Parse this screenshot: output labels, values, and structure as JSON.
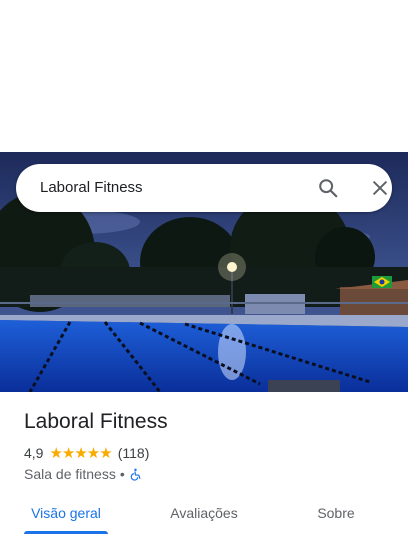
{
  "search": {
    "query": "Laboral Fitness"
  },
  "place": {
    "name": "Laboral Fitness",
    "rating": "4,9",
    "stars": "★★★★★",
    "review_count": "(118)",
    "category": "Sala de fitness",
    "separator": "•"
  },
  "tabs": [
    {
      "label": "Visão geral"
    },
    {
      "label": "Avaliações"
    },
    {
      "label": "Sobre"
    }
  ],
  "icons": {
    "search": "search-icon",
    "close": "close-icon",
    "accessibility": "wheelchair-icon"
  },
  "colors": {
    "accent": "#1a73e8",
    "star": "#f9ab00",
    "pool": "#0a3ea8"
  }
}
